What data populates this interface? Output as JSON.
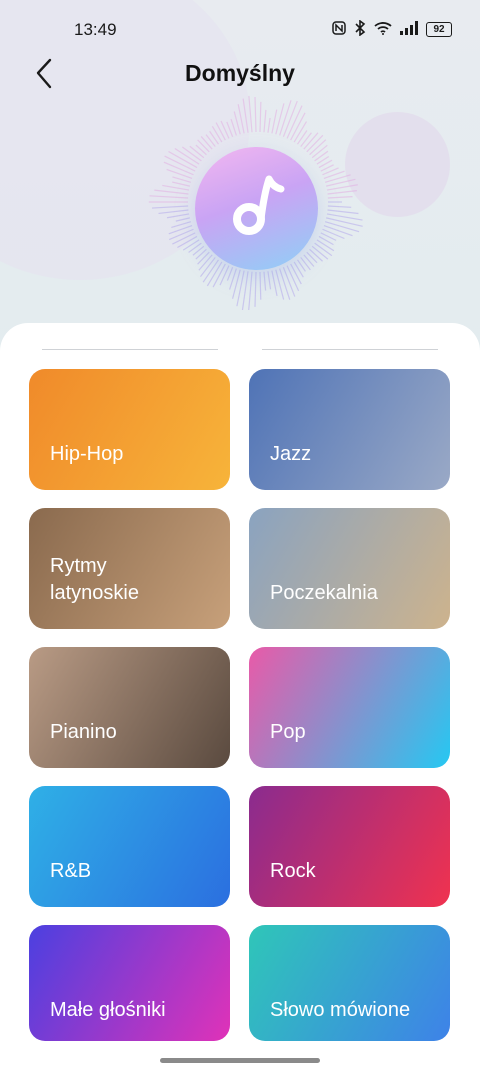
{
  "status_bar": {
    "time": "13:49",
    "battery": "92",
    "icons": [
      "nfc-icon",
      "bluetooth-icon",
      "wifi-icon",
      "signal-icon",
      "battery-icon"
    ]
  },
  "header": {
    "title": "Domyślny",
    "back_icon": "chevron-left-icon"
  },
  "genres": [
    {
      "label": "Hip-Hop",
      "colors": [
        "#f08a2a",
        "#f7b43a"
      ]
    },
    {
      "label": "Jazz",
      "colors": [
        "#4f73b6",
        "#9aa9c6"
      ]
    },
    {
      "label": "Rytmy latynoskie",
      "colors": [
        "#8a6a4e",
        "#c7a07a"
      ]
    },
    {
      "label": "Poczekalnia",
      "colors": [
        "#8aa3c0",
        "#cdb38d"
      ]
    },
    {
      "label": "Pianino",
      "colors": [
        "#b99b85",
        "#5a4a3f"
      ]
    },
    {
      "label": "Pop",
      "colors": [
        "#e95aa8",
        "#25c8f2"
      ]
    },
    {
      "label": "R&B",
      "colors": [
        "#2fb0e6",
        "#2b6fe0"
      ]
    },
    {
      "label": "Rock",
      "colors": [
        "#8a2b8f",
        "#f0324f"
      ]
    },
    {
      "label": "Małe głośniki",
      "colors": [
        "#4b40e0",
        "#e032b8"
      ]
    },
    {
      "label": "Słowo mówione",
      "colors": [
        "#2fc6b8",
        "#3e82e8"
      ]
    }
  ]
}
